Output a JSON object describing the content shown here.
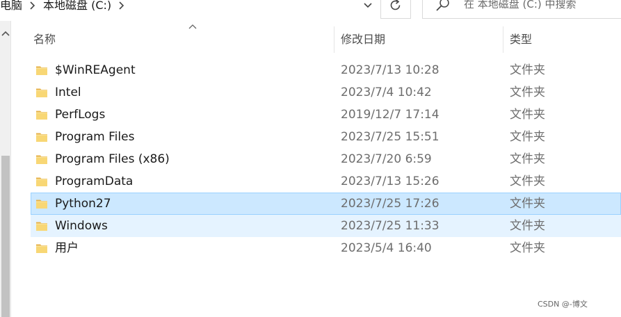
{
  "address_bar": {
    "breadcrumbs": [
      "此电脑",
      "本地磁盘 (C:)"
    ],
    "search_placeholder": "在 本地磁盘 (C:) 中搜索"
  },
  "columns": {
    "name": "名称",
    "modified": "修改日期",
    "type": "类型"
  },
  "rows": [
    {
      "name": "$WinREAgent",
      "modified": "2023/7/13 10:28",
      "type": "文件夹",
      "state": "normal"
    },
    {
      "name": "Intel",
      "modified": "2023/7/4 10:42",
      "type": "文件夹",
      "state": "normal"
    },
    {
      "name": "PerfLogs",
      "modified": "2019/12/7 17:14",
      "type": "文件夹",
      "state": "normal"
    },
    {
      "name": "Program Files",
      "modified": "2023/7/25 15:51",
      "type": "文件夹",
      "state": "normal"
    },
    {
      "name": "Program Files (x86)",
      "modified": "2023/7/20 6:59",
      "type": "文件夹",
      "state": "normal"
    },
    {
      "name": "ProgramData",
      "modified": "2023/7/13 15:26",
      "type": "文件夹",
      "state": "normal"
    },
    {
      "name": "Python27",
      "modified": "2023/7/25 17:26",
      "type": "文件夹",
      "state": "selected"
    },
    {
      "name": "Windows",
      "modified": "2023/7/25 11:33",
      "type": "文件夹",
      "state": "hover"
    },
    {
      "name": "用户",
      "modified": "2023/5/4 16:40",
      "type": "文件夹",
      "state": "normal"
    }
  ],
  "watermark": "CSDN @-博文",
  "colors": {
    "selected_row": "#cce8ff",
    "selected_border": "#99d1ff",
    "hover_row": "#e5f3ff",
    "folder": "#f8d775"
  },
  "icons": [
    "chevron-right-icon",
    "chevron-down-icon",
    "refresh-icon",
    "search-icon",
    "folder-icon",
    "sort-ascending-icon",
    "scroll-up-icon"
  ]
}
